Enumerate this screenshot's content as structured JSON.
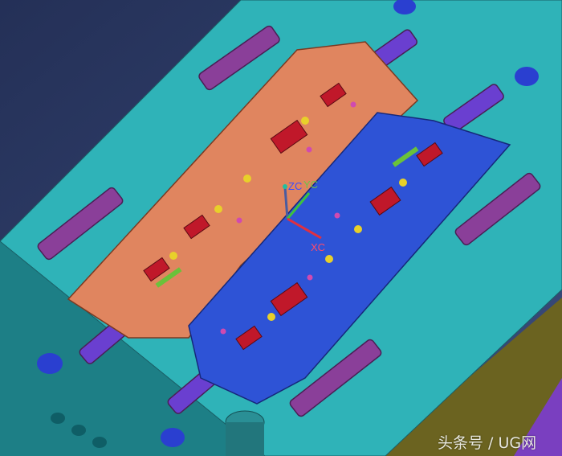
{
  "viewport": {
    "triad": {
      "zc_label": "ZC",
      "yc_label": "YC",
      "xc_label": "XC"
    },
    "watermark": "头条号 / UG网"
  },
  "colors": {
    "background": "#2a3560",
    "plate": "#2fb3b8",
    "plate_side": "#1d7f86",
    "cavity": "#e0855f",
    "core": "#2e53d6",
    "rail": "#8a3f99",
    "insert": "#c0182a",
    "olive": "#6b6320",
    "purple": "#7a3fc0"
  }
}
